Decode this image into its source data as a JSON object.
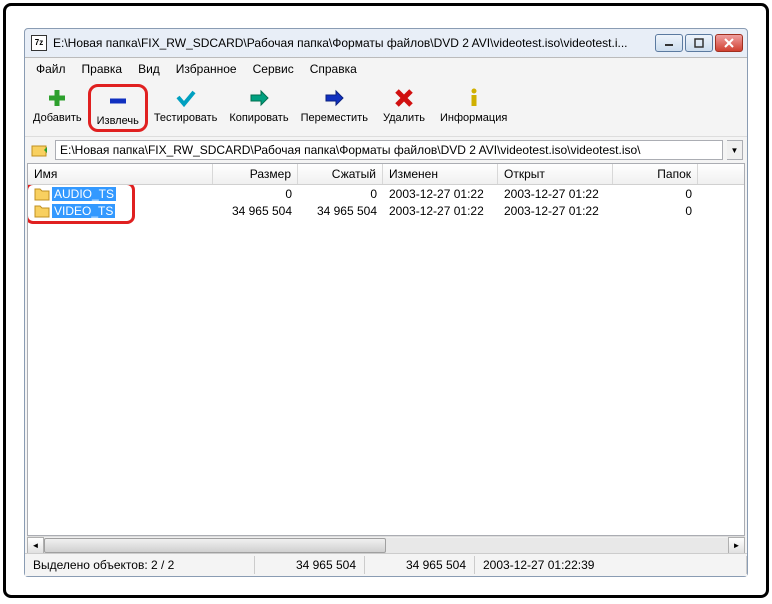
{
  "title": "E:\\Новая папка\\FIX_RW_SDCARD\\Рабочая папка\\Форматы файлов\\DVD 2 AVI\\videotest.iso\\videotest.i...",
  "menu": [
    "Файл",
    "Правка",
    "Вид",
    "Избранное",
    "Сервис",
    "Справка"
  ],
  "toolbar": [
    {
      "id": "add",
      "label": "Добавить"
    },
    {
      "id": "extract",
      "label": "Извлечь"
    },
    {
      "id": "test",
      "label": "Тестировать"
    },
    {
      "id": "copy",
      "label": "Копировать"
    },
    {
      "id": "move",
      "label": "Переместить"
    },
    {
      "id": "delete",
      "label": "Удалить"
    },
    {
      "id": "info",
      "label": "Информация"
    }
  ],
  "address": "E:\\Новая папка\\FIX_RW_SDCARD\\Рабочая папка\\Форматы файлов\\DVD 2 AVI\\videotest.iso\\videotest.iso\\",
  "columns": {
    "name": "Имя",
    "size": "Размер",
    "packed": "Сжатый",
    "modified": "Изменен",
    "opened": "Открыт",
    "folders": "Папок"
  },
  "rows": [
    {
      "name": "AUDIO_TS",
      "size": "0",
      "packed": "0",
      "modified": "2003-12-27 01:22",
      "opened": "2003-12-27 01:22",
      "folders": "0"
    },
    {
      "name": "VIDEO_TS",
      "size": "34 965 504",
      "packed": "34 965 504",
      "modified": "2003-12-27 01:22",
      "opened": "2003-12-27 01:22",
      "folders": "0"
    }
  ],
  "status": {
    "selected": "Выделено объектов: 2 / 2",
    "size": "34 965 504",
    "packed": "34 965 504",
    "date": "2003-12-27 01:22:39"
  },
  "app_icon_text": "7z"
}
